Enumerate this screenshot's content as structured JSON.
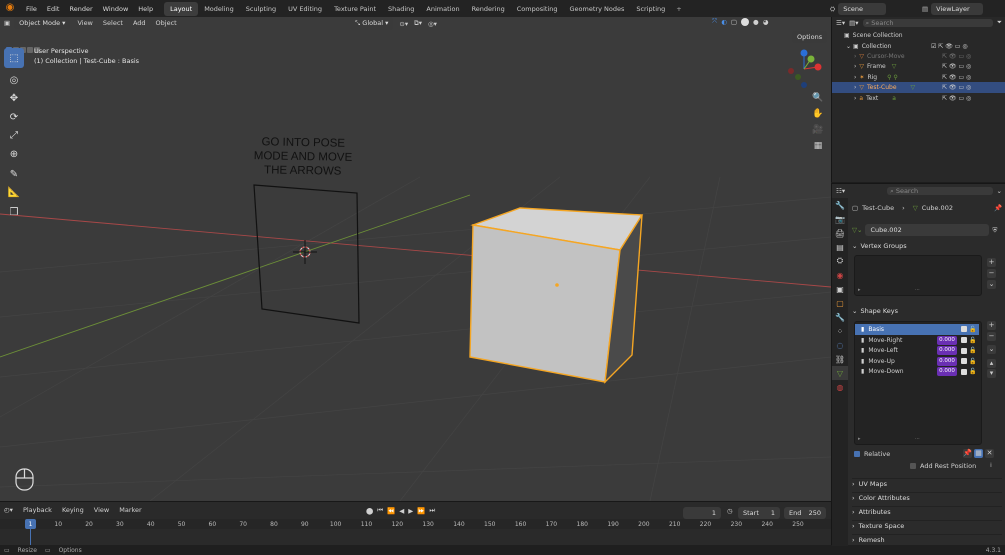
{
  "menu": [
    "File",
    "Edit",
    "Render",
    "Window",
    "Help"
  ],
  "workspaces": [
    "Layout",
    "Modeling",
    "Sculpting",
    "UV Editing",
    "Texture Paint",
    "Shading",
    "Animation",
    "Rendering",
    "Compositing",
    "Geometry Nodes",
    "Scripting"
  ],
  "active_workspace": "Layout",
  "scene": "Scene",
  "view_layer": "ViewLayer",
  "viewport": {
    "mode": "Object Mode",
    "view": "View",
    "select": "Select",
    "add": "Add",
    "object": "Object",
    "orientation": "Global",
    "options": "Options",
    "perspective": "User Perspective",
    "context": "(1) Collection | Test-Cube : Basis",
    "sign_text": [
      "GO INTO POSE",
      "MODE AND MOVE",
      "THE ARROWS"
    ]
  },
  "outliner": {
    "search": "Search",
    "rows": [
      {
        "name": "Scene Collection"
      },
      {
        "name": "Collection"
      },
      {
        "name": "Cursor-Move"
      },
      {
        "name": "Frame"
      },
      {
        "name": "Rig"
      },
      {
        "name": "Test-Cube"
      },
      {
        "name": "Text"
      }
    ]
  },
  "properties": {
    "search": "Search",
    "breadcrumb_obj": "Test-Cube",
    "breadcrumb_mesh": "Cube.002",
    "mesh_name": "Cube.002",
    "vertex_groups": "Vertex Groups",
    "shape_keys": "Shape Keys",
    "keys": [
      {
        "name": "Basis",
        "value": ""
      },
      {
        "name": "Move-Right",
        "value": "0.000"
      },
      {
        "name": "Move-Left",
        "value": "0.000"
      },
      {
        "name": "Move-Up",
        "value": "0.000"
      },
      {
        "name": "Move-Down",
        "value": "0.000"
      }
    ],
    "relative": "Relative",
    "add_rest": "Add Rest Position",
    "panels": [
      "UV Maps",
      "Color Attributes",
      "Attributes",
      "Texture Space",
      "Remesh"
    ]
  },
  "timeline": {
    "playback": "Playback",
    "keying": "Keying",
    "view": "View",
    "marker": "Marker",
    "current": "1",
    "start_label": "Start",
    "start": "1",
    "end_label": "End",
    "end": "250",
    "ticks": [
      "1",
      "10",
      "20",
      "30",
      "40",
      "50",
      "60",
      "70",
      "80",
      "90",
      "100",
      "110",
      "120",
      "130",
      "140",
      "150",
      "160",
      "170",
      "180",
      "190",
      "200",
      "210",
      "220",
      "230",
      "240",
      "250"
    ]
  },
  "status": {
    "resize": "Resize",
    "options": "Options",
    "version": "4.3.1"
  },
  "colors": {
    "accent": "#4772b3",
    "selection": "#f5a623",
    "shape_value": "#6a2fb3"
  }
}
